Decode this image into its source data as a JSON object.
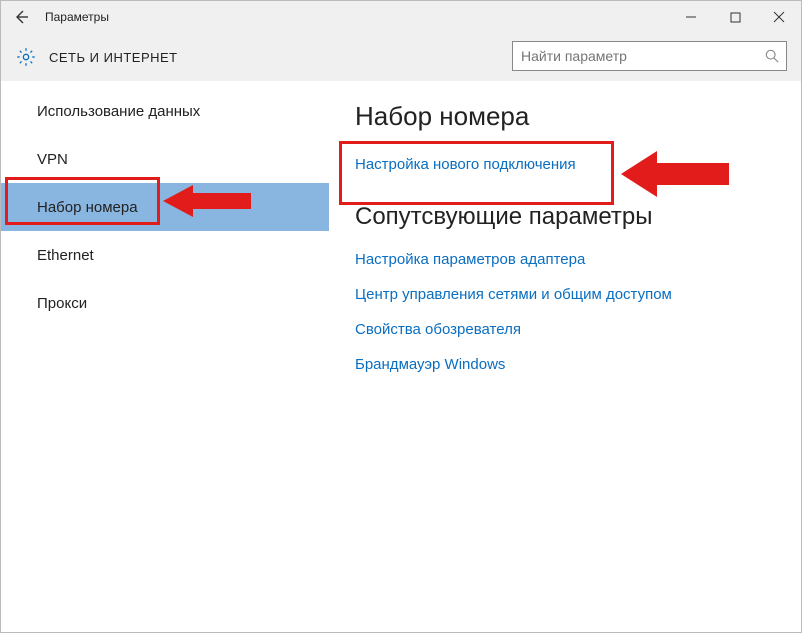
{
  "window": {
    "title": "Параметры"
  },
  "header": {
    "section_title": "СЕТЬ И ИНТЕРНЕТ"
  },
  "search": {
    "placeholder": "Найти параметр"
  },
  "sidebar": {
    "items": [
      {
        "label": "Использование данных",
        "selected": false
      },
      {
        "label": "VPN",
        "selected": false
      },
      {
        "label": "Набор номера",
        "selected": true
      },
      {
        "label": "Ethernet",
        "selected": false
      },
      {
        "label": "Прокси",
        "selected": false
      }
    ]
  },
  "main": {
    "heading": "Набор номера",
    "primary_link": "Настройка нового подключения",
    "related_heading": "Сопутсвующие параметры",
    "related_links": [
      "Настройка параметров адаптера",
      "Центр управления сетями и общим доступом",
      "Свойства обозревателя",
      "Брандмауэр Windows"
    ]
  }
}
